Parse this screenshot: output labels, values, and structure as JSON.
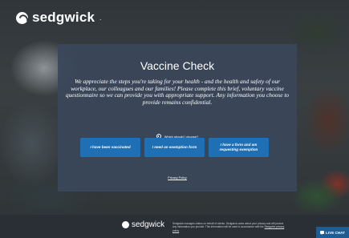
{
  "brand": {
    "name": "sedgwick",
    "dot": "."
  },
  "modal": {
    "title": "Vaccine Check",
    "intro": "We appreciate the steps you're taking for your health - and the health and safety of our workplace, our colleagues and our families! Please complete this brief, voluntary vaccine questionnaire so we can provide you with appropriate support. Any information you choose to provide remains confidential.",
    "why_link": "Which should I choose?",
    "buttons": [
      "I have been vaccinated",
      "I need an exemption form",
      "I have a form and am requesting exemption"
    ],
    "privacy": "Privacy Policy"
  },
  "footer": {
    "brand": "sedgwick",
    "text": "Sedgwick manages claims on behalf of clients. Sedgwick cares about your privacy and will protect any information you provide. This information will be used in accordance with the",
    "link": "Sedgwick privacy policy"
  },
  "live_chat": {
    "label": "LIVE CHAT"
  },
  "colors": {
    "modal_bg": "#3a475a",
    "button": "#1f6fb4",
    "footer_bg": "#2a2f36",
    "chat_bg": "#1d5d94"
  },
  "icons": {
    "logo": "sedgwick-logo-icon",
    "info": "info-icon",
    "chat": "chat-icon"
  }
}
